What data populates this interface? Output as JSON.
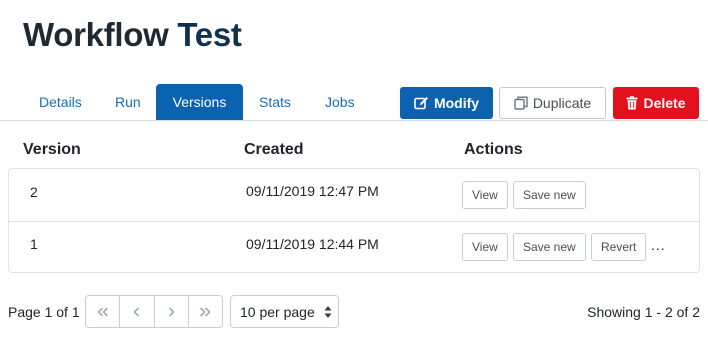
{
  "title": {
    "part1": "Workflow",
    "part2": "Test"
  },
  "tabs": [
    {
      "label": "Details",
      "active": false
    },
    {
      "label": "Run",
      "active": false
    },
    {
      "label": "Versions",
      "active": true
    },
    {
      "label": "Stats",
      "active": false
    },
    {
      "label": "Jobs",
      "active": false
    }
  ],
  "actions": {
    "modify_label": "Modify",
    "duplicate_label": "Duplicate",
    "delete_label": "Delete"
  },
  "table": {
    "columns": [
      "Version",
      "Created",
      "Actions"
    ],
    "rows": [
      {
        "version": "2",
        "created": "09/11/2019 12:47 PM",
        "buttons": [
          "View",
          "Save new"
        ],
        "more": ""
      },
      {
        "version": "1",
        "created": "09/11/2019 12:44 PM",
        "buttons": [
          "View",
          "Save new",
          "Revert"
        ],
        "more": "..."
      }
    ]
  },
  "pagination": {
    "page_info": "Page 1 of 1",
    "per_page": "10 per page",
    "showing": "Showing 1 - 2 of 2"
  },
  "colors": {
    "primary": "#0b63b0",
    "danger": "#e3101e",
    "link": "#1b6db5"
  }
}
